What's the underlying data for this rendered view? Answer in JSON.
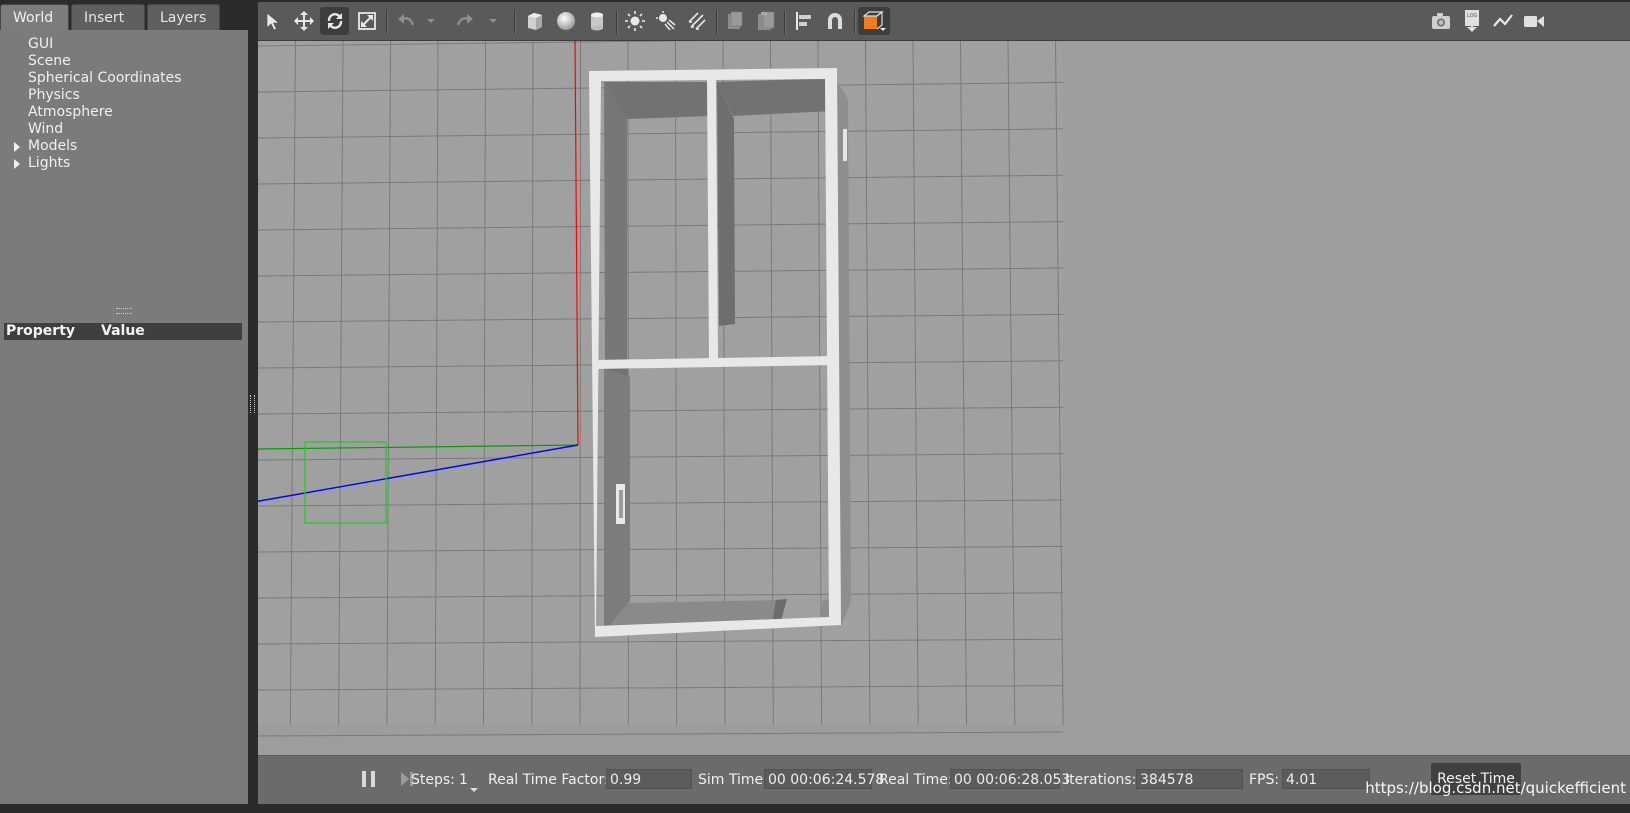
{
  "tabs": [
    {
      "label": "World",
      "active": true
    },
    {
      "label": "Insert",
      "active": false
    },
    {
      "label": "Layers",
      "active": false
    }
  ],
  "world_tree": [
    {
      "label": "GUI",
      "expandable": false
    },
    {
      "label": "Scene",
      "expandable": false
    },
    {
      "label": "Spherical Coordinates",
      "expandable": false
    },
    {
      "label": "Physics",
      "expandable": false
    },
    {
      "label": "Atmosphere",
      "expandable": false
    },
    {
      "label": "Wind",
      "expandable": false
    },
    {
      "label": "Models",
      "expandable": true
    },
    {
      "label": "Lights",
      "expandable": true
    }
  ],
  "property_table": {
    "property_header": "Property",
    "value_header": "Value"
  },
  "toolbar": {
    "left_tools": [
      "select-arrow-icon",
      "translate-icon",
      "rotate-icon",
      "scale-icon",
      "undo-icon",
      "undo-dropdown-icon",
      "redo-icon",
      "redo-dropdown-icon",
      "box-shape-icon",
      "sphere-shape-icon",
      "cylinder-shape-icon",
      "point-light-icon",
      "spot-light-icon",
      "directional-light-icon",
      "copy-icon",
      "paste-icon",
      "align-icon",
      "snap-icon",
      "view-angle-icon"
    ],
    "active_tool": "rotate-icon",
    "right_tools": [
      "camera-screenshot-icon",
      "log-icon",
      "plot-icon",
      "video-record-icon"
    ],
    "accent_color": "#f07d1a"
  },
  "bottom_bar": {
    "steps_label": "Steps:",
    "steps_value": "1",
    "rtf_label": "Real Time Factor:",
    "rtf_value": "0.99",
    "sim_time_label": "Sim Time:",
    "sim_time_value": "00 00:06:24.578",
    "real_time_label": "Real Time:",
    "real_time_value": "00 00:06:28.053",
    "iterations_label": "Iterations:",
    "iterations_value": "384578",
    "fps_label": "FPS:",
    "fps_value": "4.01",
    "reset_label": "Reset Time"
  },
  "watermark": "https://blog.csdn.net/quickefficient",
  "colors": {
    "panel_bg": "#7b7b7b",
    "viewport_bg": "#9d9d9d",
    "grid_line": "#7f7f7f",
    "wall_top": "#ececec",
    "wall_side": "#777777",
    "axis_x": "#ff0000",
    "axis_y": "#00a000",
    "axis_z": "#0000ff"
  }
}
